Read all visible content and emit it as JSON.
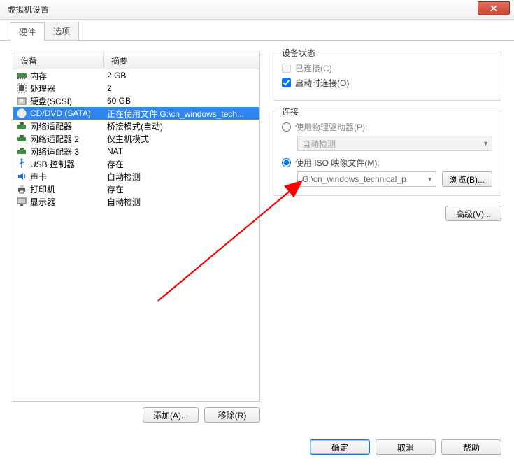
{
  "window": {
    "title": "虚拟机设置"
  },
  "tabs": {
    "hardware": "硬件",
    "options": "选项",
    "active": 0
  },
  "hw_table": {
    "headers": {
      "device": "设备",
      "summary": "摘要"
    },
    "rows": [
      {
        "icon": "memory-icon",
        "device": "内存",
        "summary": "2 GB"
      },
      {
        "icon": "cpu-icon",
        "device": "处理器",
        "summary": "2"
      },
      {
        "icon": "disk-icon",
        "device": "硬盘(SCSI)",
        "summary": "60 GB"
      },
      {
        "icon": "cd-icon",
        "device": "CD/DVD (SATA)",
        "summary": "正在使用文件 G:\\cn_windows_tech...",
        "selected": true
      },
      {
        "icon": "net-icon",
        "device": "网络适配器",
        "summary": "桥接模式(自动)"
      },
      {
        "icon": "net-icon",
        "device": "网络适配器 2",
        "summary": "仅主机模式"
      },
      {
        "icon": "net-icon",
        "device": "网络适配器 3",
        "summary": "NAT"
      },
      {
        "icon": "usb-icon",
        "device": "USB 控制器",
        "summary": "存在"
      },
      {
        "icon": "sound-icon",
        "device": "声卡",
        "summary": "自动检测"
      },
      {
        "icon": "printer-icon",
        "device": "打印机",
        "summary": "存在"
      },
      {
        "icon": "display-icon",
        "device": "显示器",
        "summary": "自动检测"
      }
    ]
  },
  "left_buttons": {
    "add": "添加(A)...",
    "remove": "移除(R)"
  },
  "status": {
    "legend": "设备状态",
    "connected": "已连接(C)",
    "connected_checked": false,
    "connected_enabled": false,
    "connect_on": "启动时连接(O)",
    "connect_on_checked": true
  },
  "connection": {
    "legend": "连接",
    "physical": "使用物理驱动器(P):",
    "physical_combo": "自动检测",
    "iso": "使用 ISO 映像文件(M):",
    "iso_combo": "G:\\cn_windows_technical_p",
    "browse": "浏览(B)...",
    "selected": "iso"
  },
  "advanced": "高级(V)...",
  "dialog": {
    "ok": "确定",
    "cancel": "取消",
    "help": "帮助"
  }
}
